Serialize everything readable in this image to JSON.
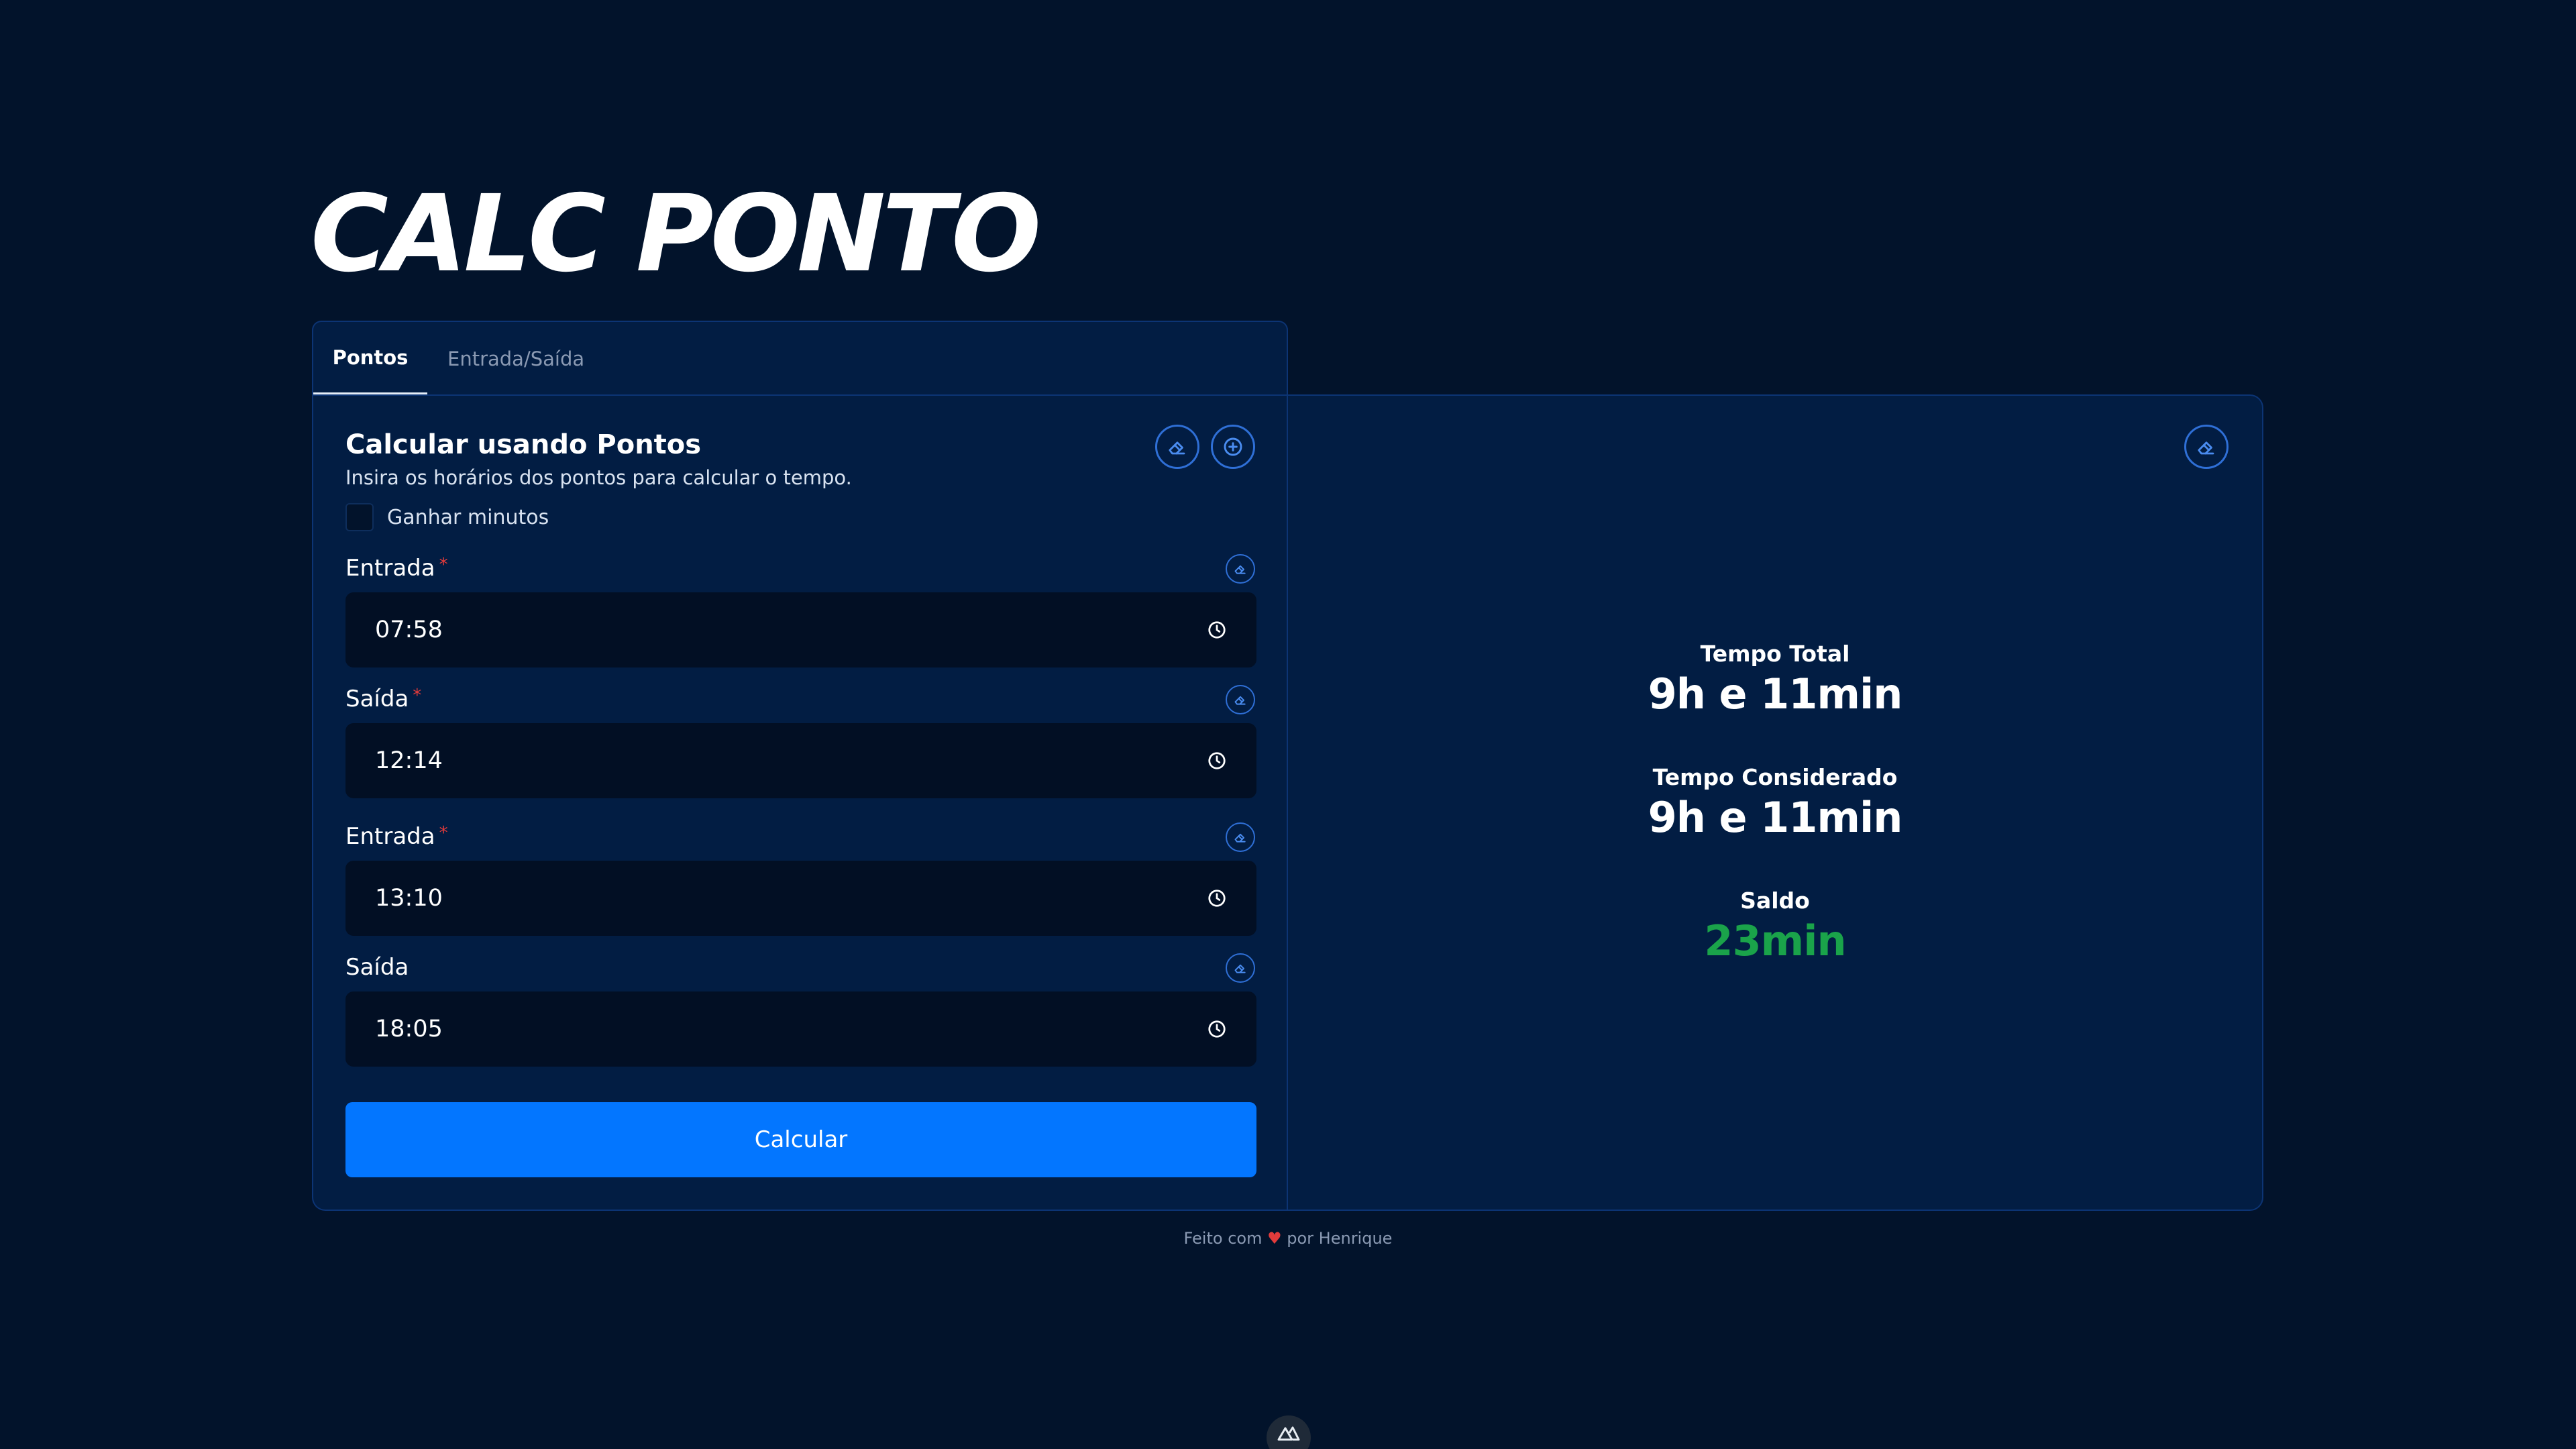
{
  "app": {
    "title": "CALC PONTO"
  },
  "tabs": [
    {
      "label": "Pontos",
      "active": true
    },
    {
      "label": "Entrada/Saída",
      "active": false
    }
  ],
  "form": {
    "title": "Calcular usando Pontos",
    "description": "Insira os horários dos pontos para calcular o tempo.",
    "checkbox_label": "Ganhar minutos",
    "checkbox_checked": false,
    "required_mark": "*",
    "fields": [
      {
        "label": "Entrada",
        "value": "07:58",
        "required": true
      },
      {
        "label": "Saída",
        "value": "12:14",
        "required": true
      },
      {
        "label": "Entrada",
        "value": "13:10",
        "required": true
      },
      {
        "label": "Saída",
        "value": "18:05",
        "required": false
      }
    ],
    "submit_label": "Calcular"
  },
  "results": {
    "total_label": "Tempo Total",
    "total_value": "9h e 11min",
    "considered_label": "Tempo Considerado",
    "considered_value": "9h e 11min",
    "balance_label": "Saldo",
    "balance_value": "23min"
  },
  "footer": {
    "prefix": "Feito com",
    "heart": "♥",
    "suffix": "por Henrique"
  },
  "colors": {
    "background": "#02132b",
    "panel": "#021d43",
    "accent": "#0376ff",
    "positive": "#1aa34a",
    "required": "#e23b3b"
  },
  "icons": {
    "eraser": "eraser-icon",
    "add": "plus-circle-icon",
    "clock": "clock-icon",
    "nuxt": "nuxt-icon"
  }
}
